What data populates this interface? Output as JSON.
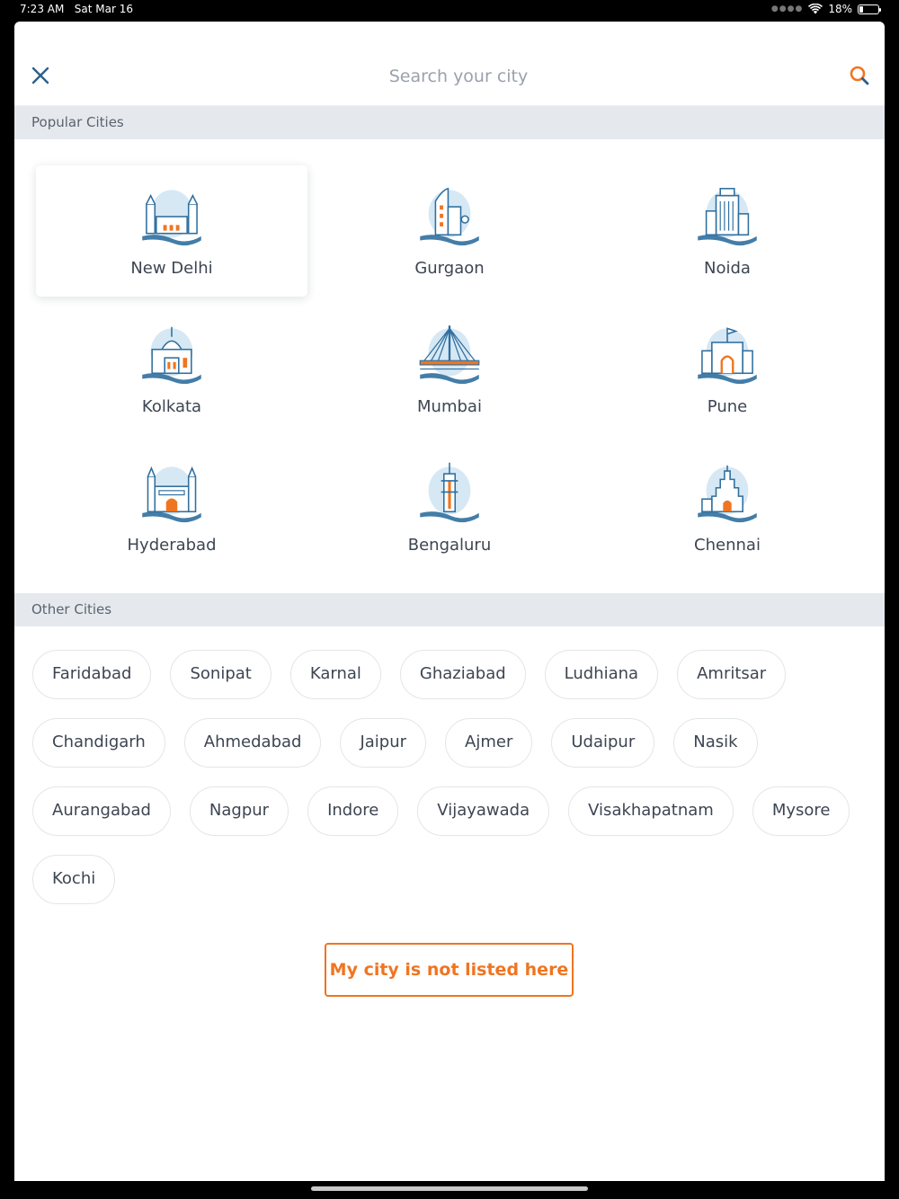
{
  "status_bar": {
    "time": "7:23 AM",
    "date": "Sat Mar 16",
    "battery_text": "18%",
    "battery_level": 0.18
  },
  "header": {
    "search_placeholder": "Search your city",
    "icons": [
      "close-icon",
      "search-icon"
    ]
  },
  "popular": {
    "title": "Popular Cities",
    "cities": [
      {
        "name": "New Delhi",
        "icon": "india-gate-monument-icon",
        "selected": true
      },
      {
        "name": "Gurgaon",
        "icon": "cyber-tower-icon",
        "selected": false
      },
      {
        "name": "Noida",
        "icon": "skyscraper-icon",
        "selected": false
      },
      {
        "name": "Kolkata",
        "icon": "victoria-memorial-icon",
        "selected": false
      },
      {
        "name": "Mumbai",
        "icon": "sea-link-bridge-icon",
        "selected": false
      },
      {
        "name": "Pune",
        "icon": "shaniwar-wada-icon",
        "selected": false
      },
      {
        "name": "Hyderabad",
        "icon": "charminar-icon",
        "selected": false
      },
      {
        "name": "Bengaluru",
        "icon": "tower-icon",
        "selected": false
      },
      {
        "name": "Chennai",
        "icon": "temple-gopuram-icon",
        "selected": false
      }
    ]
  },
  "other": {
    "title": "Other Cities",
    "rows": [
      [
        "Faridabad",
        "Sonipat",
        "Karnal",
        "Ghaziabad",
        "Ludhiana",
        "Amritsar"
      ],
      [
        "Chandigarh",
        "Ahmedabad",
        "Jaipur",
        "Ajmer",
        "Udaipur",
        "Nasik"
      ],
      [
        "Aurangabad",
        "Nagpur",
        "Indore",
        "Vijayawada",
        "Visakhapatnam",
        "Mysore"
      ],
      [
        "Kochi"
      ]
    ]
  },
  "not_listed_label": "My city is not listed here",
  "colors": {
    "accent": "#ef7521",
    "icon_blue": "#2f6f9f",
    "icon_bg": "#d6e8f4",
    "section_bg": "#e5e9ed"
  }
}
